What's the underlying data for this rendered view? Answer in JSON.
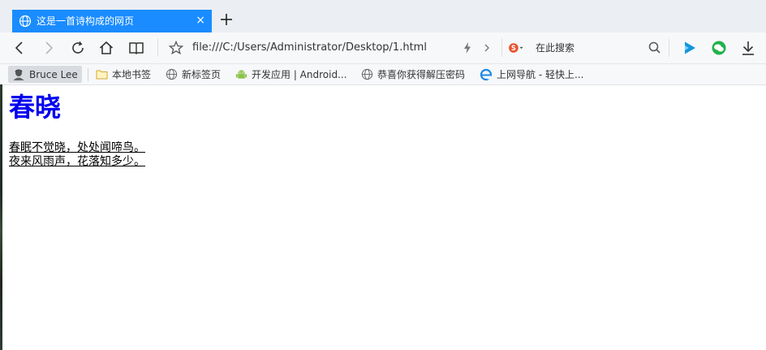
{
  "tab": {
    "title": "这是一首诗构成的网页",
    "close": "×"
  },
  "toolbar": {
    "url": "file:///C:/Users/Administrator/Desktop/1.html",
    "search_placeholder": "在此搜索",
    "icons": [
      "back-icon",
      "forward-icon",
      "reload-icon",
      "home-icon",
      "reader-icon",
      "star-icon",
      "lightning-icon",
      "chevron-right-icon",
      "sogou-search-icon",
      "search-icon",
      "play-icon",
      "wechat-icon",
      "download-icon"
    ]
  },
  "bookmarks": {
    "user": "Bruce Lee",
    "items": [
      {
        "label": "本地书签",
        "icon": "folder-icon"
      },
      {
        "label": "新标签页",
        "icon": "globe-icon"
      },
      {
        "label": "开发应用 | Android...",
        "icon": "android-icon"
      },
      {
        "label": "恭喜你获得解压密码",
        "icon": "globe-icon"
      },
      {
        "label": "上网导航 - 轻快上...",
        "icon": "ie-icon"
      }
    ]
  },
  "page": {
    "heading": "春晓",
    "lines": [
      "春眠不觉晓，处处闻啼鸟。",
      "夜来风雨声，花落知多少。"
    ]
  },
  "colors": {
    "tab_active": "#1a8cff",
    "heading": "#0000ee",
    "accent_blue": "#1296db",
    "wechat_green": "#22b14c"
  }
}
